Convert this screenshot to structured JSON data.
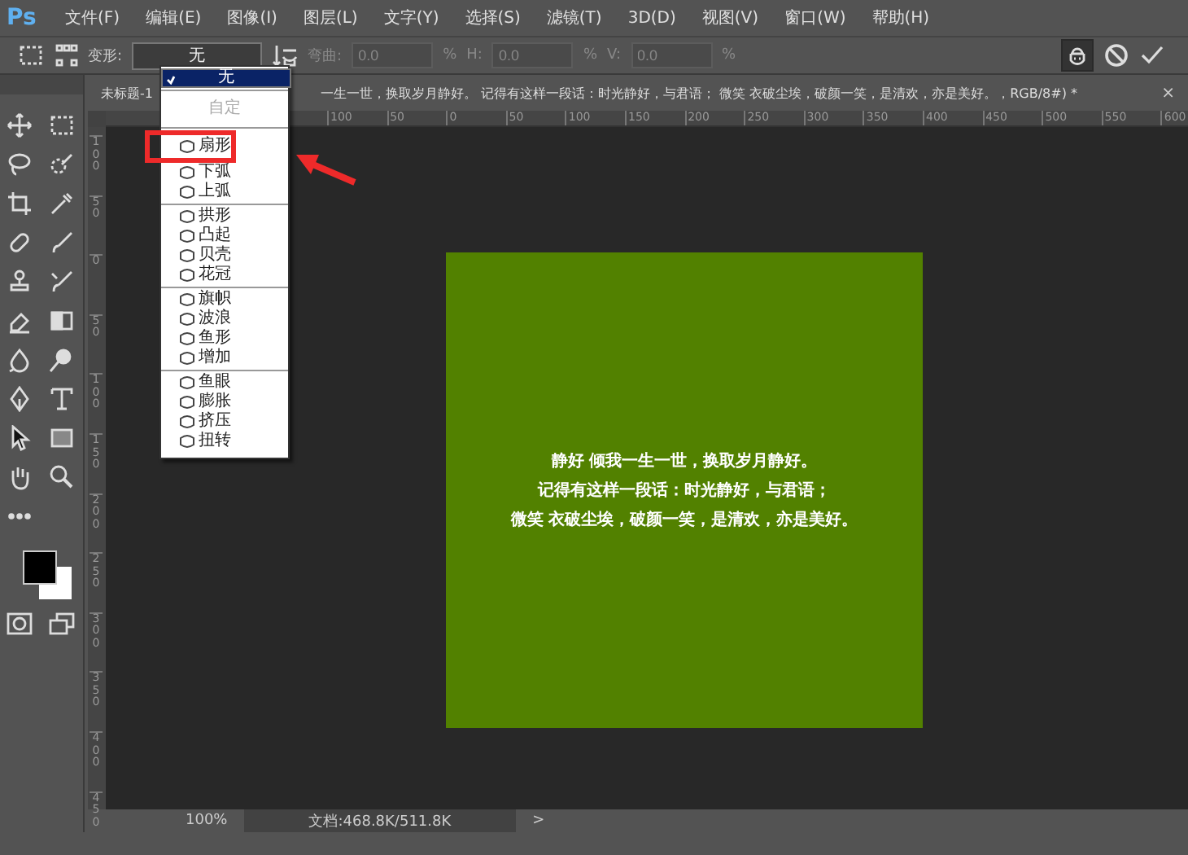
{
  "menu_bar": {
    "logo": "Ps",
    "items": [
      "文件(F)",
      "编辑(E)",
      "图像(I)",
      "图层(L)",
      "文字(Y)",
      "选择(S)",
      "滤镜(T)",
      "3D(D)",
      "视图(V)",
      "窗口(W)",
      "帮助(H)"
    ]
  },
  "options_bar": {
    "warp_label": "变形:",
    "warp_value": "无",
    "fields_disabled": true,
    "fields": [
      {
        "label": "弯曲:",
        "value": "0.0",
        "unit": "%"
      },
      {
        "label": "H:",
        "value": "0.0",
        "unit": "%"
      },
      {
        "label": "V:",
        "value": "0.0",
        "unit": "%"
      }
    ],
    "puppet_pressed": true
  },
  "document_tab": {
    "title_start": "未标题-1",
    "title_rest": "一生一世，换取岁月静好。 记得有这样一段话：时光静好，与君语； 微笑 衣破尘埃，破颜一笑，是清欢，亦是美好。，RGB/8#) *",
    "close": "×"
  },
  "ruler_horizontal": [
    "100",
    "50",
    "0",
    "50",
    "100",
    "150",
    "200",
    "250",
    "300",
    "350",
    "400",
    "450",
    "500",
    "550",
    "600"
  ],
  "ruler_vertical": [
    "100",
    "50",
    "0",
    "50",
    "100",
    "150",
    "200",
    "250",
    "300",
    "350",
    "400",
    "450"
  ],
  "canvas": {
    "lines": [
      "静好 倾我一生一世，换取岁月静好。",
      "记得有这样一段话：时光静好，与君语；",
      "微笑 衣破尘埃，破颜一笑，是清欢，亦是美好。"
    ]
  },
  "warp_menu": {
    "groups": [
      [
        {
          "label": "无",
          "selected": true,
          "disabled": false,
          "annotated": false
        }
      ],
      [
        {
          "label": "自定",
          "selected": false,
          "disabled": true,
          "annotated": false
        }
      ],
      [
        {
          "label": "扇形",
          "selected": false,
          "disabled": false,
          "annotated": true
        },
        {
          "label": "下弧",
          "selected": false,
          "disabled": false,
          "annotated": false
        },
        {
          "label": "上弧",
          "selected": false,
          "disabled": false,
          "annotated": false
        }
      ],
      [
        {
          "label": "拱形",
          "selected": false,
          "disabled": false,
          "annotated": false
        },
        {
          "label": "凸起",
          "selected": false,
          "disabled": false,
          "annotated": false
        },
        {
          "label": "贝壳",
          "selected": false,
          "disabled": false,
          "annotated": false
        },
        {
          "label": "花冠",
          "selected": false,
          "disabled": false,
          "annotated": false
        }
      ],
      [
        {
          "label": "旗帜",
          "selected": false,
          "disabled": false,
          "annotated": false
        },
        {
          "label": "波浪",
          "selected": false,
          "disabled": false,
          "annotated": false
        },
        {
          "label": "鱼形",
          "selected": false,
          "disabled": false,
          "annotated": false
        },
        {
          "label": "增加",
          "selected": false,
          "disabled": false,
          "annotated": false
        }
      ],
      [
        {
          "label": "鱼眼",
          "selected": false,
          "disabled": false,
          "annotated": false
        },
        {
          "label": "膨胀",
          "selected": false,
          "disabled": false,
          "annotated": false
        },
        {
          "label": "挤压",
          "selected": false,
          "disabled": false,
          "annotated": false
        },
        {
          "label": "扭转",
          "selected": false,
          "disabled": false,
          "annotated": false
        }
      ]
    ]
  },
  "status_bar": {
    "zoom": "100%",
    "doc": "文档:468.8K/511.8K",
    "arrow": ">"
  }
}
